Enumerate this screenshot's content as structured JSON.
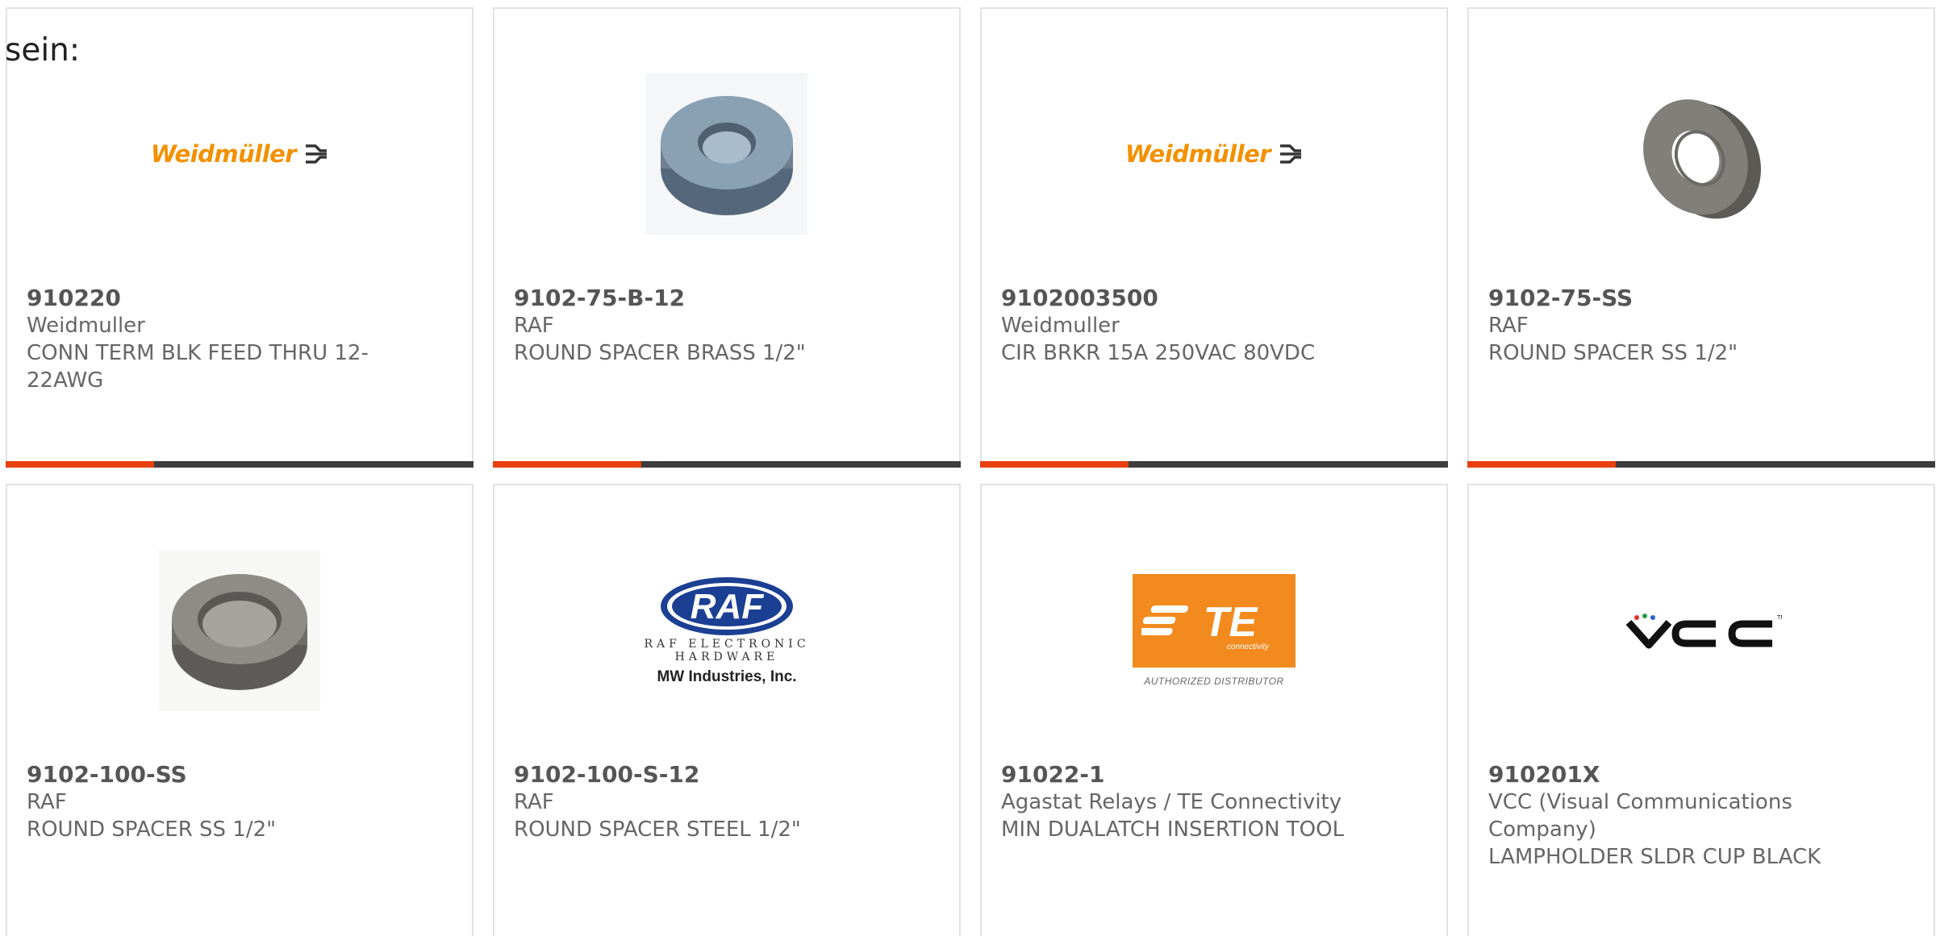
{
  "intro_text": "sein:",
  "colors": {
    "accent_bar": "#e8400f",
    "bar": "#3d3d3d",
    "border": "#e2e2e2",
    "weidmuller_orange": "#f29100",
    "te_orange": "#f28a1e",
    "raf_blue": "#1b3f93"
  },
  "products": [
    {
      "part": "910220",
      "manufacturer": "Weidmuller",
      "description": "CONN TERM BLK FEED THRU 12-22AWG",
      "image": "weidmuller-logo",
      "logo_text": "Weidmüller"
    },
    {
      "part": "9102-75-B-12",
      "manufacturer": "RAF",
      "description": "ROUND SPACER BRASS 1/2\"",
      "image": "round-spacer-photo"
    },
    {
      "part": "9102003500",
      "manufacturer": "Weidmuller",
      "description": "CIR BRKR 15A 250VAC 80VDC",
      "image": "weidmuller-logo",
      "logo_text": "Weidmüller"
    },
    {
      "part": "9102-75-SS",
      "manufacturer": "RAF",
      "description": "ROUND SPACER SS 1/2\"",
      "image": "round-spacer-photo"
    },
    {
      "part": "9102-100-SS",
      "manufacturer": "RAF",
      "description": "ROUND SPACER SS 1/2\"",
      "image": "round-spacer-photo"
    },
    {
      "part": "9102-100-S-12",
      "manufacturer": "RAF",
      "description": "ROUND SPACER STEEL 1/2\"",
      "image": "raf-logo",
      "logo_text": "RAF",
      "logo_sub1": "RAF ELECTRONIC",
      "logo_sub2": "HARDWARE",
      "logo_sub3": "MW Industries, Inc."
    },
    {
      "part": "91022-1",
      "manufacturer": "Agastat Relays / TE Connectivity",
      "description": "MIN DUALATCH INSERTION TOOL",
      "image": "te-logo",
      "logo_text": "TE",
      "logo_sub1": "connectivity",
      "logo_sub2": "AUTHORIZED DISTRIBUTOR"
    },
    {
      "part": "910201X",
      "manufacturer": "VCC (Visual Communications Company)",
      "description": "LAMPHOLDER SLDR CUP BLACK",
      "image": "vcc-logo",
      "logo_text": "VCC"
    }
  ]
}
